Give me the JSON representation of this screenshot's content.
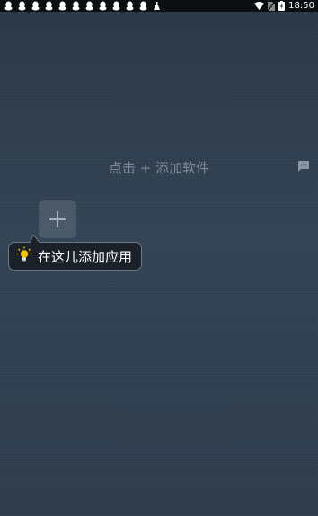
{
  "status_bar": {
    "time": "18:50",
    "notification_icons": [
      "qq-icon",
      "qq-icon",
      "qq-icon",
      "qq-icon",
      "qq-icon",
      "qq-icon",
      "qq-icon",
      "qq-icon",
      "qq-icon",
      "qq-icon",
      "qq-icon",
      "cleaner-icon"
    ],
    "system_icons": [
      "wifi-icon",
      "no-sim-icon",
      "battery-icon"
    ]
  },
  "home": {
    "hint": "点击 + 添加软件",
    "add_button_symbol": "+",
    "tooltip": "在这儿添加应用"
  },
  "colors": {
    "background": "#2f3e4f",
    "hint_text": "#7d8b9b",
    "tooltip_bg": "#1b2128",
    "bulb": "#f5c400"
  }
}
